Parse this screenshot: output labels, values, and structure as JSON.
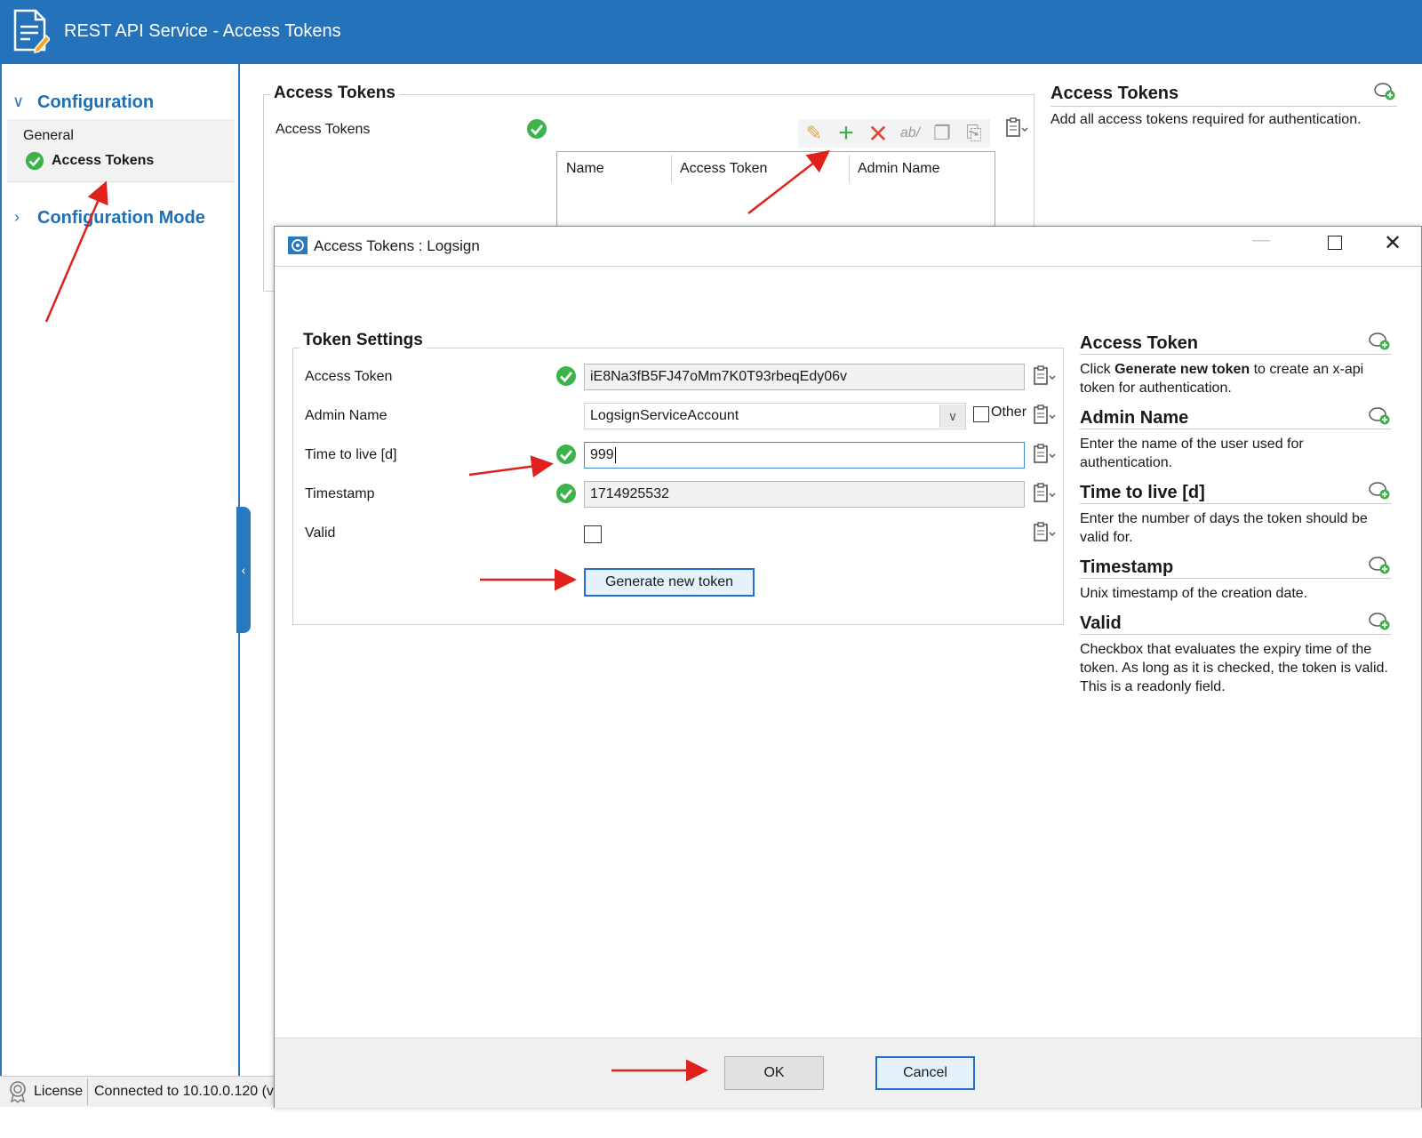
{
  "window": {
    "title": "REST API Service - Access Tokens"
  },
  "nav": {
    "configuration": "Configuration",
    "general": "General",
    "access_tokens": "Access Tokens",
    "configuration_mode": "Configuration Mode"
  },
  "main": {
    "group_title": "Access Tokens",
    "field_label": "Access Tokens",
    "grid_headers": [
      "Name",
      "Access Token",
      "Admin Name"
    ],
    "help_title": "Access Tokens",
    "help_text": "Add all access tokens required for authentication."
  },
  "dialog": {
    "title": "Access Tokens : Logsign",
    "group_title": "Token Settings",
    "fields": {
      "access_token": {
        "label": "Access Token",
        "value": "iE8Na3fB5FJ47oMm7K0T93rbeqEdy06v"
      },
      "admin_name": {
        "label": "Admin Name",
        "value": "LogsignServiceAccount",
        "other_label": "Other"
      },
      "ttl": {
        "label": "Time to live [d]",
        "value": "999"
      },
      "timestamp": {
        "label": "Timestamp",
        "value": "1714925532"
      },
      "valid": {
        "label": "Valid"
      }
    },
    "generate_button": "Generate new token",
    "ok_button": "OK",
    "cancel_button": "Cancel",
    "help": [
      {
        "title": "Access Token",
        "text_pre": "Click ",
        "text_bold": "Generate new token",
        "text_post": " to create an x-api token for authentication."
      },
      {
        "title": "Admin Name",
        "text": "Enter the name of the user used for authentication."
      },
      {
        "title": "Time to live [d]",
        "text": "Enter the number of days the token should be valid for."
      },
      {
        "title": "Timestamp",
        "text": "Unix timestamp of the creation date."
      },
      {
        "title": "Valid",
        "text": "Checkbox that evaluates the expiry time of the token. As long as it is checked, the token is valid. This is a readonly field."
      }
    ]
  },
  "statusbar": {
    "license": "License",
    "connection": "Connected to 10.10.0.120 (v"
  },
  "colors": {
    "titlebar": "#2473ba",
    "accent": "#1e6fb9",
    "ok_check": "#3cb44b",
    "arrow": "#e0201a"
  }
}
